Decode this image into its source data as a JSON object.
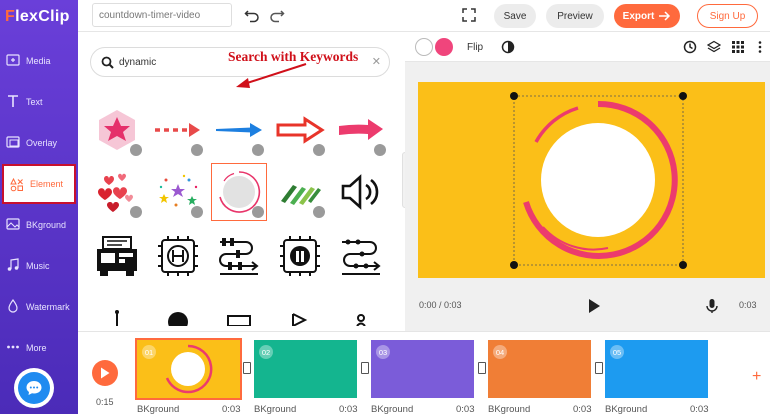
{
  "app": {
    "logo_mark": "F",
    "logo_rest": "lexClip"
  },
  "topbar": {
    "project_name": "countdown-timer-video",
    "save_label": "Save",
    "preview_label": "Preview",
    "export_label": "Export",
    "signup_label": "Sign Up"
  },
  "sidebar": {
    "items": [
      {
        "label": "Media",
        "icon": "media-icon"
      },
      {
        "label": "Text",
        "icon": "text-icon"
      },
      {
        "label": "Overlay",
        "icon": "overlay-icon"
      },
      {
        "label": "Element",
        "icon": "element-icon",
        "active": true
      },
      {
        "label": "BKground",
        "icon": "background-icon"
      },
      {
        "label": "Music",
        "icon": "music-icon"
      },
      {
        "label": "Watermark",
        "icon": "watermark-icon"
      },
      {
        "label": "More",
        "icon": "more-icon"
      }
    ]
  },
  "panel": {
    "search_value": "dynamic",
    "annotation": "Search with Keywords"
  },
  "preview": {
    "flip_label": "Flip",
    "time_current": "0:00 / 0:03",
    "time_total": "0:03",
    "stage_color": "#fbbf18"
  },
  "timeline": {
    "play_time": "0:15",
    "clips": [
      {
        "num": "01",
        "label": "BKground",
        "duration": "0:03",
        "color": "#fbbf18"
      },
      {
        "num": "02",
        "label": "BKground",
        "duration": "0:03",
        "color": "#14b58f"
      },
      {
        "num": "03",
        "label": "BKground",
        "duration": "0:03",
        "color": "#7b5cd9"
      },
      {
        "num": "04",
        "label": "BKground",
        "duration": "0:03",
        "color": "#f07e36"
      },
      {
        "num": "05",
        "label": "BKground",
        "duration": "0:03",
        "color": "#1d9bf0"
      }
    ]
  },
  "colors": {
    "accent": "#ff6a3d",
    "sidebar": "#5a35c8",
    "annotation": "#d0101a",
    "pink": "#f0457c"
  }
}
